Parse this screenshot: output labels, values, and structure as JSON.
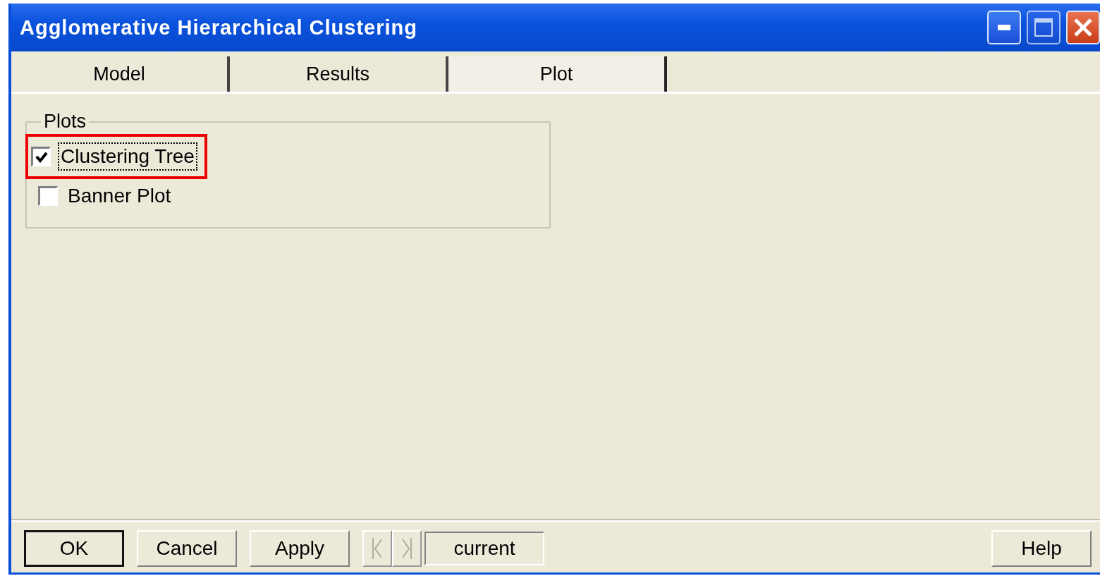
{
  "window": {
    "title": "Agglomerative Hierarchical Clustering"
  },
  "tabs": [
    {
      "label": "Model",
      "selected": false
    },
    {
      "label": "Results",
      "selected": false
    },
    {
      "label": "Plot",
      "selected": true
    }
  ],
  "plots_group": {
    "title": "Plots",
    "options": [
      {
        "label": "Clustering Tree",
        "checked": true,
        "focused": true,
        "highlighted": true
      },
      {
        "label": "Banner Plot",
        "checked": false,
        "focused": false,
        "highlighted": false
      }
    ]
  },
  "buttons": [
    {
      "label": "OK",
      "default": true
    },
    {
      "label": "Cancel",
      "default": false
    },
    {
      "label": "Apply",
      "default": false
    }
  ],
  "navigation": {
    "disabled": true,
    "current": "current"
  },
  "help_button": {
    "label": "Help"
  }
}
